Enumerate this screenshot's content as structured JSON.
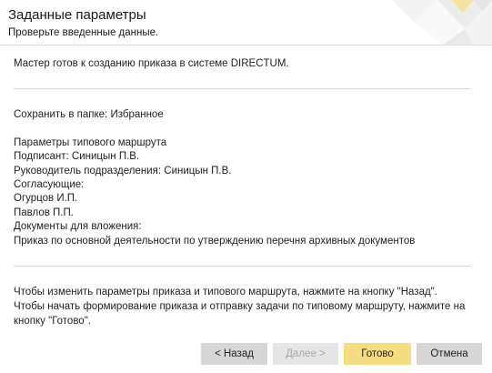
{
  "header": {
    "title": "Заданные параметры",
    "subtitle": "Проверьте введенные данные."
  },
  "main": {
    "intro": "Мастер готов к созданию приказа в системе DIRECTUM.",
    "details": [
      "Сохранить в папке: Избранное",
      "",
      "Параметры типового маршрута",
      "Подписант: Синицын П.В.",
      "Руководитель подразделения: Синицын П.В.",
      "Согласующие:",
      "Огурцов И.П.",
      "Павлов П.П.",
      "Документы для вложения:",
      "Приказ по основной деятельности по утверждению перечня архивных документов"
    ],
    "instructions": "Чтобы изменить параметры приказа и типового маршрута, нажмите на кнопку \"Назад\". Чтобы начать формирование приказа и отправку задачи по типовому маршруту, нажмите на кнопку \"Готово\"."
  },
  "buttons": {
    "back": "< Назад",
    "next": "Далее >",
    "finish": "Готово",
    "cancel": "Отмена"
  },
  "colors": {
    "finish_button": "#f7dd82",
    "neutral_button": "#d6d6d6",
    "disabled_text": "#a8a8a8"
  }
}
